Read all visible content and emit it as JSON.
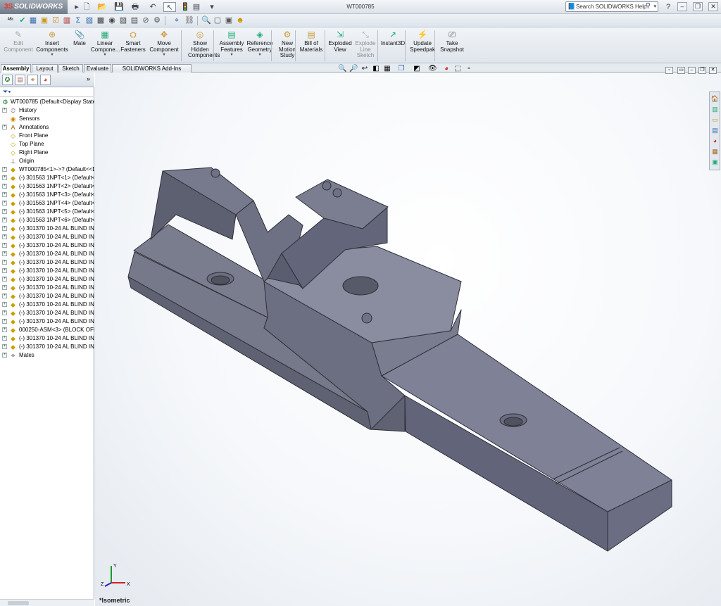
{
  "app": {
    "brand": "SOLIDWORKS",
    "brand_prefix": "3S"
  },
  "title": "WT000785",
  "search": {
    "placeholder": "Search SOLIDWORKS Help"
  },
  "window_controls": {
    "minimize": "–",
    "restore": "❐",
    "close": "✕"
  },
  "commands": [
    {
      "label": "Edit Component",
      "icon": "edit-component-icon",
      "disabled": true
    },
    {
      "label": "Insert Components",
      "icon": "insert-components-icon"
    },
    {
      "label": "Mate",
      "icon": "mate-icon"
    },
    {
      "label": "Linear Compone...",
      "icon": "linear-pattern-icon"
    },
    {
      "label": "Smart Fasteners",
      "icon": "smart-fasteners-icon"
    },
    {
      "label": "Move Component",
      "icon": "move-component-icon"
    },
    {
      "label": "Show Hidden Components",
      "icon": "show-hidden-icon"
    },
    {
      "label": "Assembly Features",
      "icon": "assembly-features-icon"
    },
    {
      "label": "Reference Geometry",
      "icon": "reference-geometry-icon"
    },
    {
      "label": "New Motion Study",
      "icon": "motion-study-icon"
    },
    {
      "label": "Bill of Materials",
      "icon": "bom-icon"
    },
    {
      "label": "Exploded View",
      "icon": "exploded-view-icon"
    },
    {
      "label": "Explode Line Sketch",
      "icon": "explode-line-icon",
      "disabled": true
    },
    {
      "label": "Instant3D",
      "icon": "instant3d-icon"
    },
    {
      "label": "Update Speedpak",
      "icon": "speedpak-icon"
    },
    {
      "label": "Take Snapshot",
      "icon": "snapshot-icon"
    }
  ],
  "tabs": [
    "Assembly",
    "Layout",
    "Sketch",
    "Evaluate",
    "SOLIDWORKS Add-Ins"
  ],
  "active_tab": "Assembly",
  "tree": [
    {
      "label": "WT000785  (Default<Display State",
      "icon": "assembly-icon",
      "level": 0
    },
    {
      "label": "History",
      "icon": "history-icon",
      "level": 1,
      "expandable": true
    },
    {
      "label": "Sensors",
      "icon": "sensors-icon",
      "level": 1
    },
    {
      "label": "Annotations",
      "icon": "annotations-icon",
      "level": 1,
      "expandable": true
    },
    {
      "label": "Front Plane",
      "icon": "plane-icon",
      "level": 1
    },
    {
      "label": "Top Plane",
      "icon": "plane-icon",
      "level": 1
    },
    {
      "label": "Right Plane",
      "icon": "plane-icon",
      "level": 1
    },
    {
      "label": "Origin",
      "icon": "origin-icon",
      "level": 1
    },
    {
      "label": "WT000785<1>->? (Default<<D",
      "icon": "part-icon",
      "level": 1,
      "expandable": true
    },
    {
      "label": "(-) 301563 1NPT<1> (Default<",
      "icon": "part-icon",
      "level": 1,
      "expandable": true
    },
    {
      "label": "(-) 301563 1NPT<2> (Default<",
      "icon": "part-icon",
      "level": 1,
      "expandable": true
    },
    {
      "label": "(-) 301563 1NPT<3> (Default<",
      "icon": "part-icon",
      "level": 1,
      "expandable": true
    },
    {
      "label": "(-) 301563 1NPT<4> (Default<",
      "icon": "part-icon",
      "level": 1,
      "expandable": true
    },
    {
      "label": "(-) 301563 1NPT<5> (Default<",
      "icon": "part-icon",
      "level": 1,
      "expandable": true
    },
    {
      "label": "(-) 301563 1NPT<6> (Default<",
      "icon": "part-icon",
      "level": 1,
      "expandable": true
    },
    {
      "label": "(-) 301370 10-24 AL BLIND INS",
      "icon": "part-icon",
      "level": 1,
      "expandable": true
    },
    {
      "label": "(-) 301370 10-24 AL BLIND INS",
      "icon": "part-icon",
      "level": 1,
      "expandable": true
    },
    {
      "label": "(-) 301370 10-24 AL BLIND INS",
      "icon": "part-icon",
      "level": 1,
      "expandable": true
    },
    {
      "label": "(-) 301370 10-24 AL BLIND INS",
      "icon": "part-icon",
      "level": 1,
      "expandable": true
    },
    {
      "label": "(-) 301370 10-24 AL BLIND INS",
      "icon": "part-icon",
      "level": 1,
      "expandable": true
    },
    {
      "label": "(-) 301370 10-24 AL BLIND INS",
      "icon": "part-icon",
      "level": 1,
      "expandable": true
    },
    {
      "label": "(-) 301370 10-24 AL BLIND INS",
      "icon": "part-icon",
      "level": 1,
      "expandable": true
    },
    {
      "label": "(-) 301370 10-24 AL BLIND INS",
      "icon": "part-icon",
      "level": 1,
      "expandable": true
    },
    {
      "label": "(-) 301370 10-24 AL BLIND INS",
      "icon": "part-icon",
      "level": 1,
      "expandable": true
    },
    {
      "label": "(-) 301370 10-24 AL BLIND INS",
      "icon": "part-icon",
      "level": 1,
      "expandable": true
    },
    {
      "label": "(-) 301370 10-24 AL BLIND INS",
      "icon": "part-icon",
      "level": 1,
      "expandable": true
    },
    {
      "label": "(-) 301370 10-24 AL BLIND INS",
      "icon": "part-icon",
      "level": 1,
      "expandable": true
    },
    {
      "label": "000250-ASM<3> (BLOCK OFF",
      "icon": "subassembly-icon",
      "level": 1,
      "expandable": true
    },
    {
      "label": "(-) 301370 10-24 AL BLIND INS",
      "icon": "part-icon",
      "level": 1,
      "expandable": true
    },
    {
      "label": "(-) 301370 10-24 AL BLIND INS",
      "icon": "part-icon",
      "level": 1,
      "expandable": true
    },
    {
      "label": "Mates",
      "icon": "mates-icon",
      "level": 1,
      "expandable": true
    }
  ],
  "view": {
    "name": "*Isometric"
  },
  "triad": {
    "x": "X",
    "y": "Y",
    "z": "Z"
  },
  "colors": {
    "model_face": "#7d7f91",
    "model_side": "#5c5e6e",
    "accent": "#2255aa"
  }
}
